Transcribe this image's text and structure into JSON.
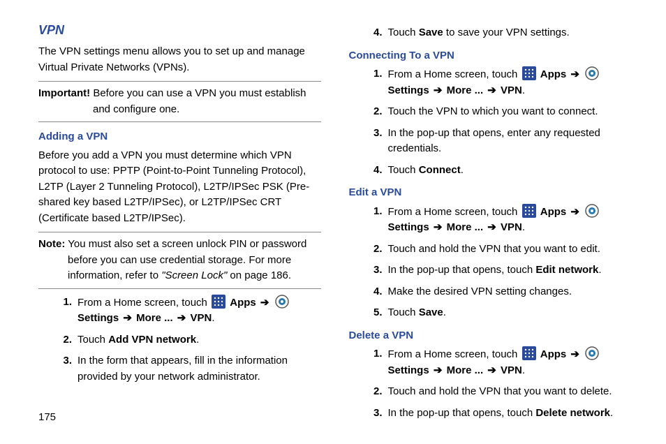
{
  "pageNumber": "175",
  "left": {
    "title": "VPN",
    "intro": "The VPN settings menu allows you to set up and manage Virtual Private Networks (VPNs).",
    "important_label": "Important!",
    "important_text": " Before you can use a VPN you must establish and configure one.",
    "h_adding": "Adding a VPN",
    "adding_intro": "Before you add a VPN you must determine which VPN protocol to use: PPTP (Point-to-Point Tunneling Protocol), L2TP (Layer 2 Tunneling Protocol), L2TP/IPSec PSK (Pre-shared key based L2TP/IPSec), or L2TP/IPSec CRT (Certificate based L2TP/IPSec).",
    "note_label": "Note:",
    "note_text1": " You must also set a screen unlock PIN or password before you can use credential storage. For more information, refer to ",
    "note_ref": "\"Screen Lock\"",
    "note_text2": "  on page 186.",
    "nav": {
      "prefix": "From a Home screen, touch ",
      "apps": "Apps",
      "settings": "Settings",
      "more": "More ...",
      "vpn": "VPN"
    },
    "step2a": "Touch ",
    "step2b": "Add VPN network",
    "step3": "In the form that appears, fill in the information provided by your network administrator."
  },
  "right": {
    "step4a": "Touch ",
    "step4b": "Save",
    "step4c": " to save your VPN settings.",
    "h_connecting": "Connecting To a VPN",
    "conn2": "Touch the VPN to which you want to connect.",
    "conn3": "In the pop-up that opens, enter any requested credentials.",
    "conn4a": "Touch ",
    "conn4b": "Connect",
    "h_edit": "Edit a VPN",
    "edit2": "Touch and hold the VPN that you want to edit.",
    "edit3a": "In the pop-up that opens, touch ",
    "edit3b": "Edit network",
    "edit4": "Make the desired VPN setting changes.",
    "edit5a": "Touch ",
    "edit5b": "Save",
    "h_delete": "Delete a VPN",
    "del2": "Touch and hold the VPN that you want to delete.",
    "del3a": "In the pop-up that opens, touch ",
    "del3b": "Delete network"
  }
}
